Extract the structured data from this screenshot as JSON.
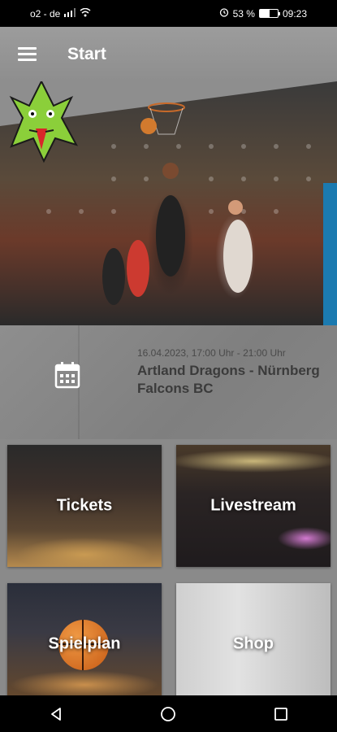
{
  "status_bar": {
    "carrier": "o2 - de",
    "battery_text": "53 %",
    "battery_level": 0.53,
    "time": "09:23",
    "icons": [
      "signal-icon",
      "wifi-icon",
      "alarm-icon",
      "battery-icon"
    ]
  },
  "app_bar": {
    "menu_icon": "hamburger-menu-icon",
    "title": "Start"
  },
  "hero": {
    "logo_icon": "dragon-logo-icon"
  },
  "event": {
    "icon": "calendar-icon",
    "date": "16.04.2023, 17:00 Uhr - 21:00 Uhr",
    "title": "Artland Dragons - Nürnberg Falcons BC"
  },
  "tiles": [
    {
      "label": "Tickets"
    },
    {
      "label": "Livestream"
    },
    {
      "label": "Spielplan"
    },
    {
      "label": "Shop"
    }
  ],
  "nav_bar": {
    "icons": [
      "back-icon",
      "home-icon",
      "recents-icon"
    ]
  },
  "colors": {
    "background": "#8a8a8a",
    "text_white": "#ffffff",
    "event_text": "#3b3b3b"
  }
}
